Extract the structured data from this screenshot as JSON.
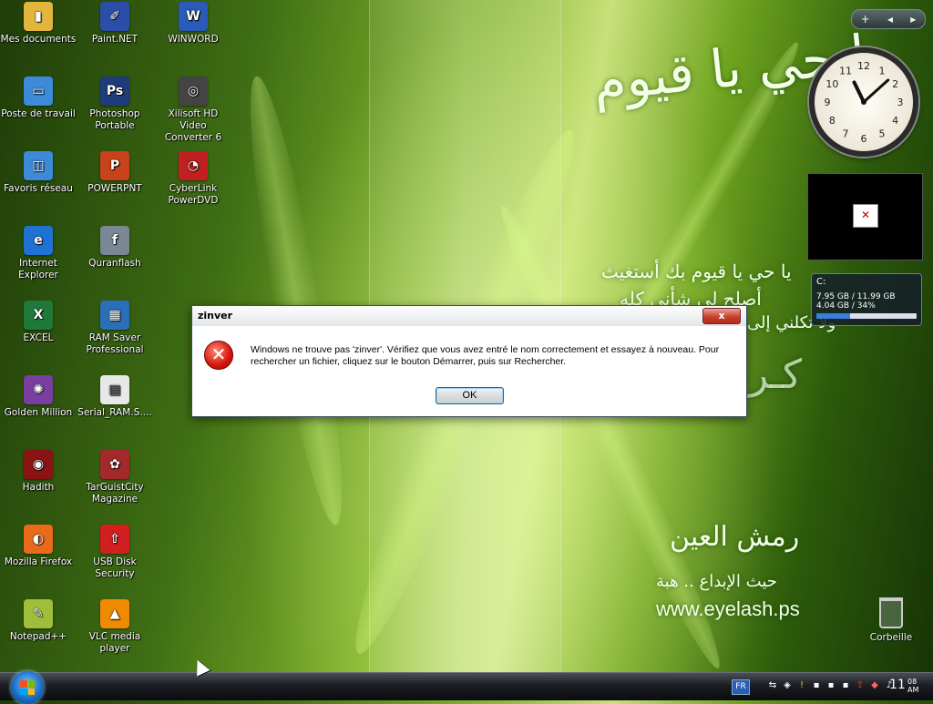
{
  "desktop": {
    "icons": [
      {
        "label": "Mes documents",
        "color": "#e2b53c",
        "glyph": "▮"
      },
      {
        "label": "Poste de travail",
        "color": "#3c8ad8",
        "glyph": "▭"
      },
      {
        "label": "Favoris réseau",
        "color": "#3c8ad8",
        "glyph": "◫"
      },
      {
        "label": "Internet Explorer",
        "color": "#1e72d4",
        "glyph": "e"
      },
      {
        "label": "EXCEL",
        "color": "#1f7a3a",
        "glyph": "X"
      },
      {
        "label": "Golden Million",
        "color": "#7a3fa0",
        "glyph": "✺"
      },
      {
        "label": "Hadith",
        "color": "#8a1313",
        "glyph": "◉"
      },
      {
        "label": "Mozilla Firefox",
        "color": "#e86a1a",
        "glyph": "◐"
      },
      {
        "label": "Notepad++",
        "color": "#9fbf3a",
        "glyph": "✎"
      },
      {
        "label": "Paint.NET",
        "color": "#2b4fa8",
        "glyph": "✐"
      },
      {
        "label": "Photoshop Portable",
        "color": "#1e3c7a",
        "glyph": "Ps"
      },
      {
        "label": "POWERPNT",
        "color": "#c8431c",
        "glyph": "P"
      },
      {
        "label": "Quranflash",
        "color": "#7a8794",
        "glyph": "f"
      },
      {
        "label": "RAM Saver Professional",
        "color": "#2a6fb8",
        "glyph": "▦"
      },
      {
        "label": "Serial_RAM.S....",
        "color": "#e8e8e8",
        "glyph": "▤"
      },
      {
        "label": "TarGuistCity Magazine",
        "color": "#a32a2a",
        "glyph": "✿"
      },
      {
        "label": "USB Disk Security",
        "color": "#d21f1f",
        "glyph": "⇧"
      },
      {
        "label": "VLC media player",
        "color": "#f08a00",
        "glyph": "▲"
      },
      {
        "label": "WINWORD",
        "color": "#2a5bb8",
        "glyph": "W"
      },
      {
        "label": "Xilisoft HD Video Converter 6",
        "color": "#444444",
        "glyph": "◎"
      },
      {
        "label": "CyberLink PowerDVD",
        "color": "#c02020",
        "glyph": "◔"
      }
    ],
    "arabic_top": "يا حي يا قيوم",
    "arabic_mid1": "يا حي يا قيوم بك أستغيث",
    "arabic_mid2": "أصلح لي شأني كله",
    "arabic_mid3": "ولا تكلني إلى",
    "arabic_mid4": "كـر",
    "logo_arabic": "رمش العين",
    "logo_tagline": "حيث الإبداع .. هبة",
    "website": "www.eyelash.ps",
    "recycle_label": "Corbeille"
  },
  "gadgets": {
    "toolbar_add": "+",
    "toolbar_prev": "◂",
    "toolbar_next": "▸",
    "clock_numbers": [
      "12",
      "1",
      "2",
      "3",
      "4",
      "5",
      "6",
      "7",
      "8",
      "9",
      "10",
      "11"
    ],
    "clock_hour": 11,
    "clock_minute": 8,
    "slideshow_broken": "✕",
    "drive_letter": "C:",
    "drive_line1": "7.95 GB / 11.99 GB",
    "drive_line2": "4.04 GB / 34%",
    "drive_used_percent": 34
  },
  "dialog": {
    "title": "zinver",
    "close": "x",
    "message": "Windows ne trouve pas 'zinver'. Vérifiez que vous avez entré le nom correctement et essayez à nouveau. Pour rechercher un fichier, cliquez sur le bouton Démarrer, puis sur Rechercher.",
    "ok": "OK"
  },
  "taskbar": {
    "lang": "FR",
    "time": "11",
    "time_minutes": "08",
    "ampm": "AM",
    "tray_icons": [
      "network-icon",
      "shield-icon",
      "alert-icon",
      "app-icon",
      "app-icon",
      "app-icon",
      "usb-icon",
      "security-icon",
      "volume-icon"
    ]
  }
}
